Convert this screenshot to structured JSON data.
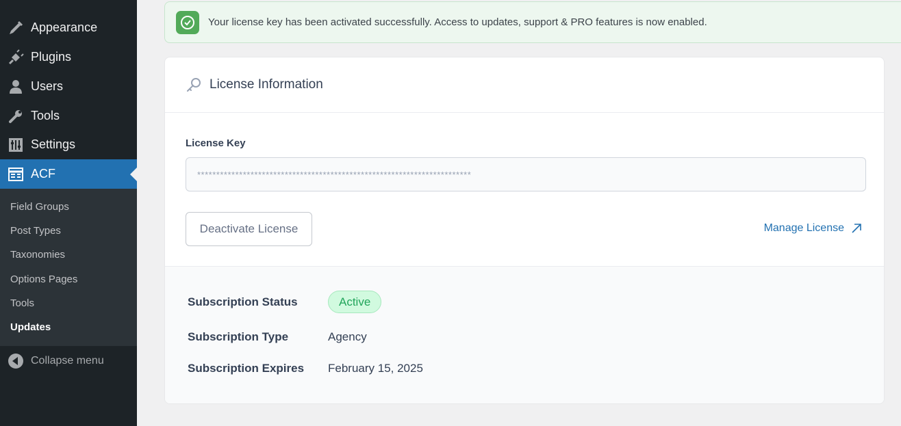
{
  "sidebar": {
    "items": [
      {
        "label": "Appearance",
        "icon": "paintbrush-icon"
      },
      {
        "label": "Plugins",
        "icon": "plugin-icon"
      },
      {
        "label": "Users",
        "icon": "users-icon"
      },
      {
        "label": "Tools",
        "icon": "wrench-icon"
      },
      {
        "label": "Settings",
        "icon": "settings-sliders-icon"
      },
      {
        "label": "ACF",
        "icon": "acf-table-icon"
      }
    ],
    "submenu": [
      "Field Groups",
      "Post Types",
      "Taxonomies",
      "Options Pages",
      "Tools",
      "Updates"
    ],
    "collapse_label": "Collapse menu"
  },
  "notice": {
    "message": "Your license key has been activated successfully. Access to updates, support & PRO features is now enabled."
  },
  "license": {
    "title": "License Information",
    "key_label": "License Key",
    "key_value": "************************************************************************",
    "deactivate_label": "Deactivate License",
    "manage_label": "Manage License"
  },
  "subscription": {
    "status_label": "Subscription Status",
    "status_value": "Active",
    "type_label": "Subscription Type",
    "type_value": "Agency",
    "expires_label": "Subscription Expires",
    "expires_value": "February 15, 2025"
  },
  "colors": {
    "sidebar_bg": "#1d2327",
    "accent": "#2271b1",
    "success": "#52aa59"
  }
}
